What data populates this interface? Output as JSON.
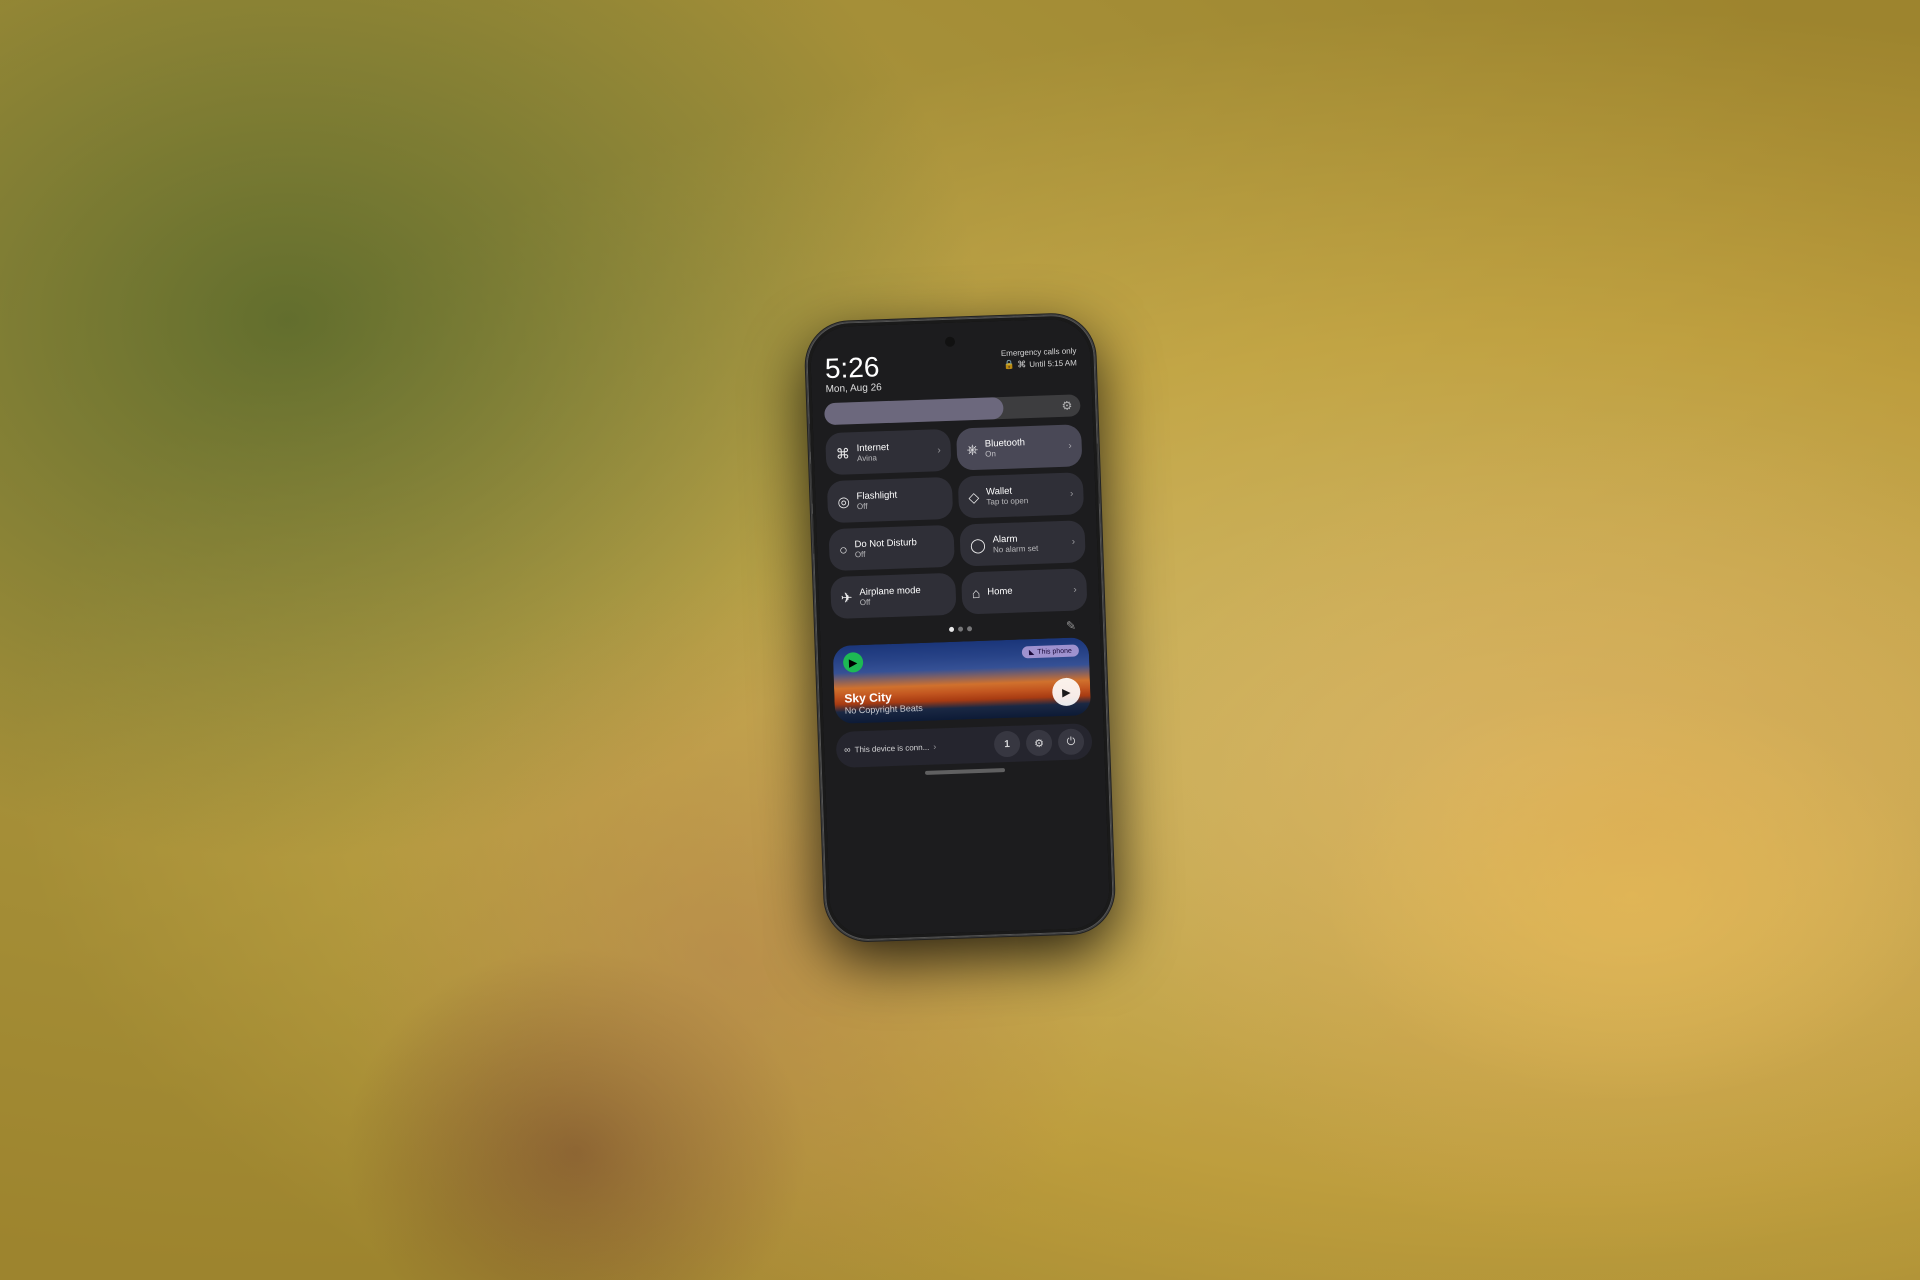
{
  "background": {
    "description": "Blurred outdoor background with bokeh"
  },
  "phone": {
    "status_bar": {
      "time": "5:26",
      "date": "Mon, Aug 26",
      "emergency_text": "Emergency calls only",
      "alarm_label": "Until 5:15 AM"
    },
    "brightness": {
      "level": 70
    },
    "tiles": [
      {
        "id": "internet",
        "icon": "wifi",
        "title": "Internet",
        "subtitle": "Avina",
        "has_arrow": true,
        "active": false
      },
      {
        "id": "bluetooth",
        "icon": "bluetooth",
        "title": "Bluetooth",
        "subtitle": "On",
        "has_arrow": true,
        "active": true
      },
      {
        "id": "flashlight",
        "icon": "flashlight",
        "title": "Flashlight",
        "subtitle": "Off",
        "has_arrow": false,
        "active": false
      },
      {
        "id": "wallet",
        "icon": "wallet",
        "title": "Wallet",
        "subtitle": "Tap to open",
        "has_arrow": true,
        "active": false
      },
      {
        "id": "do-not-disturb",
        "icon": "dnd",
        "title": "Do Not Disturb",
        "subtitle": "Off",
        "has_arrow": false,
        "active": false
      },
      {
        "id": "alarm",
        "icon": "alarm",
        "title": "Alarm",
        "subtitle": "No alarm set",
        "has_arrow": true,
        "active": false
      },
      {
        "id": "airplane-mode",
        "icon": "airplane",
        "title": "Airplane mode",
        "subtitle": "Off",
        "has_arrow": false,
        "active": false
      },
      {
        "id": "home",
        "icon": "home",
        "title": "Home",
        "subtitle": "",
        "has_arrow": true,
        "active": false
      }
    ],
    "music": {
      "app": "Spotify",
      "badge": "This phone",
      "title": "Sky City",
      "artist": "No Copyright Beats",
      "playing": true
    },
    "bottom_bar": {
      "device_text": "This device is conn...",
      "device_number": "1",
      "settings_icon": "gear",
      "power_icon": "power"
    },
    "home_indicator": true
  }
}
